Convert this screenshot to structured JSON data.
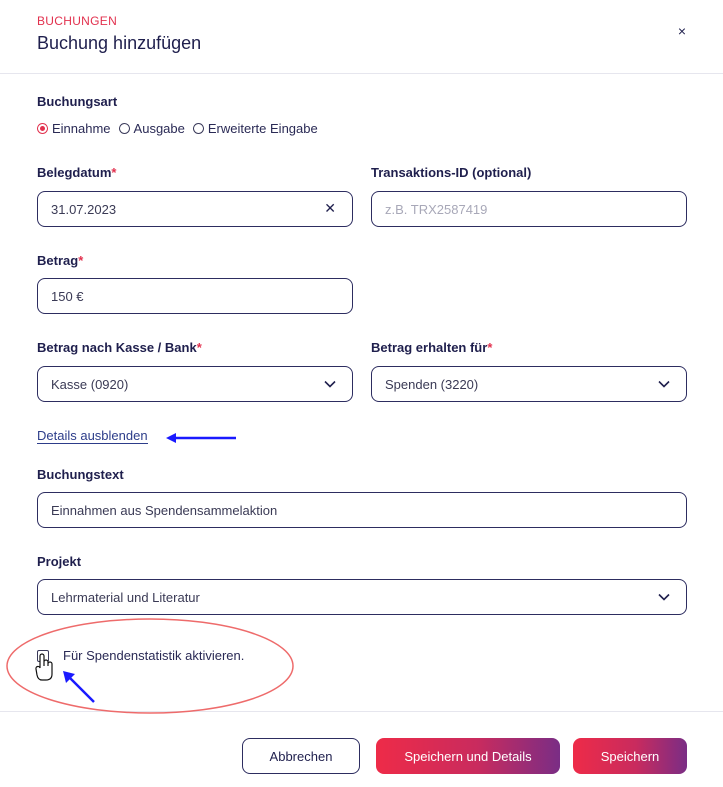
{
  "header": {
    "eyebrow": "BUCHUNGEN",
    "title": "Buchung hinzufügen",
    "close_label": "×"
  },
  "booking_type": {
    "label": "Buchungsart",
    "options": [
      {
        "label": "Einnahme",
        "checked": true
      },
      {
        "label": "Ausgabe",
        "checked": false
      },
      {
        "label": "Erweiterte Eingabe",
        "checked": false
      }
    ]
  },
  "document_date": {
    "label": "Belegdatum",
    "required_mark": "*",
    "value": "31.07.2023",
    "clear_label": "✕"
  },
  "transaction_id": {
    "label": "Transaktions-ID (optional)",
    "placeholder": "z.B. TRX2587419"
  },
  "amount": {
    "label": "Betrag",
    "required_mark": "*",
    "value": "150 €"
  },
  "cash_bank": {
    "label": "Betrag nach Kasse / Bank",
    "required_mark": "*",
    "value": "Kasse (0920)"
  },
  "received_for": {
    "label": "Betrag erhalten für",
    "required_mark": "*",
    "value": "Spenden (3220)"
  },
  "details_link": "Details ausblenden",
  "booking_text": {
    "label": "Buchungstext",
    "value": "Einnahmen aus Spendensammelaktion"
  },
  "project": {
    "label": "Projekt",
    "value": "Lehrmaterial und Literatur"
  },
  "donation_stats": {
    "label": "Für Spendenstatistik aktivieren.",
    "checked": false
  },
  "footer": {
    "cancel_label": "Abbrechen",
    "save_details_label": "Speichern und Details",
    "save_label": "Speichern"
  },
  "colors": {
    "accent": "#e2314e",
    "navy": "#1f1f4d",
    "gradient_start": "#ee2b48",
    "gradient_end": "#7a2d85",
    "annotation_blue": "#1a1aff",
    "annotation_red": "#ee6b6b"
  }
}
